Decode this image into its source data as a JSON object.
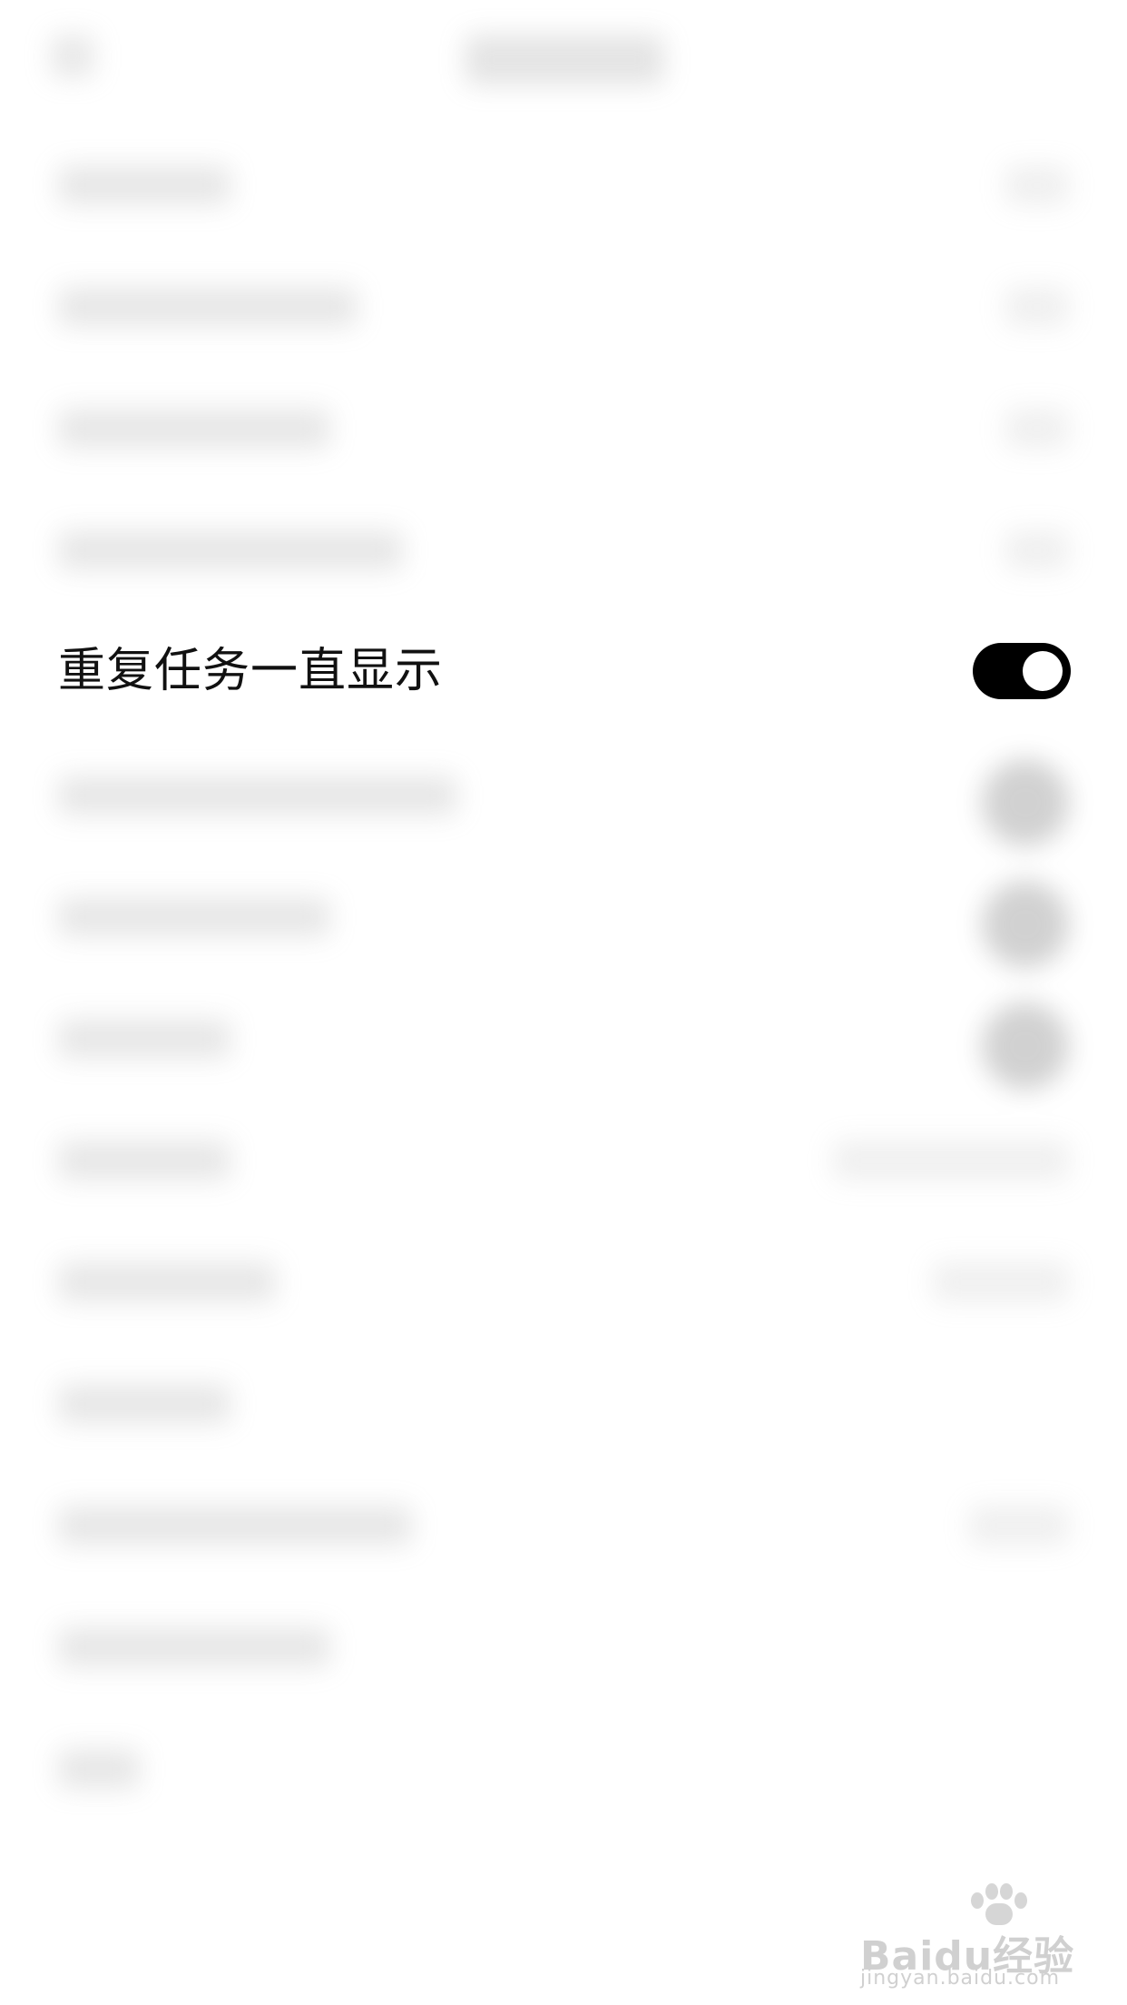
{
  "settings": {
    "focused_item": {
      "label": "重复任务一直显示",
      "toggle_on": true
    }
  },
  "watermark": {
    "brand": "Baidu经验",
    "url": "jingyan.baidu.com"
  },
  "colors": {
    "toggle_track": "#000000",
    "toggle_knob": "#ffffff",
    "background": "#ffffff"
  }
}
